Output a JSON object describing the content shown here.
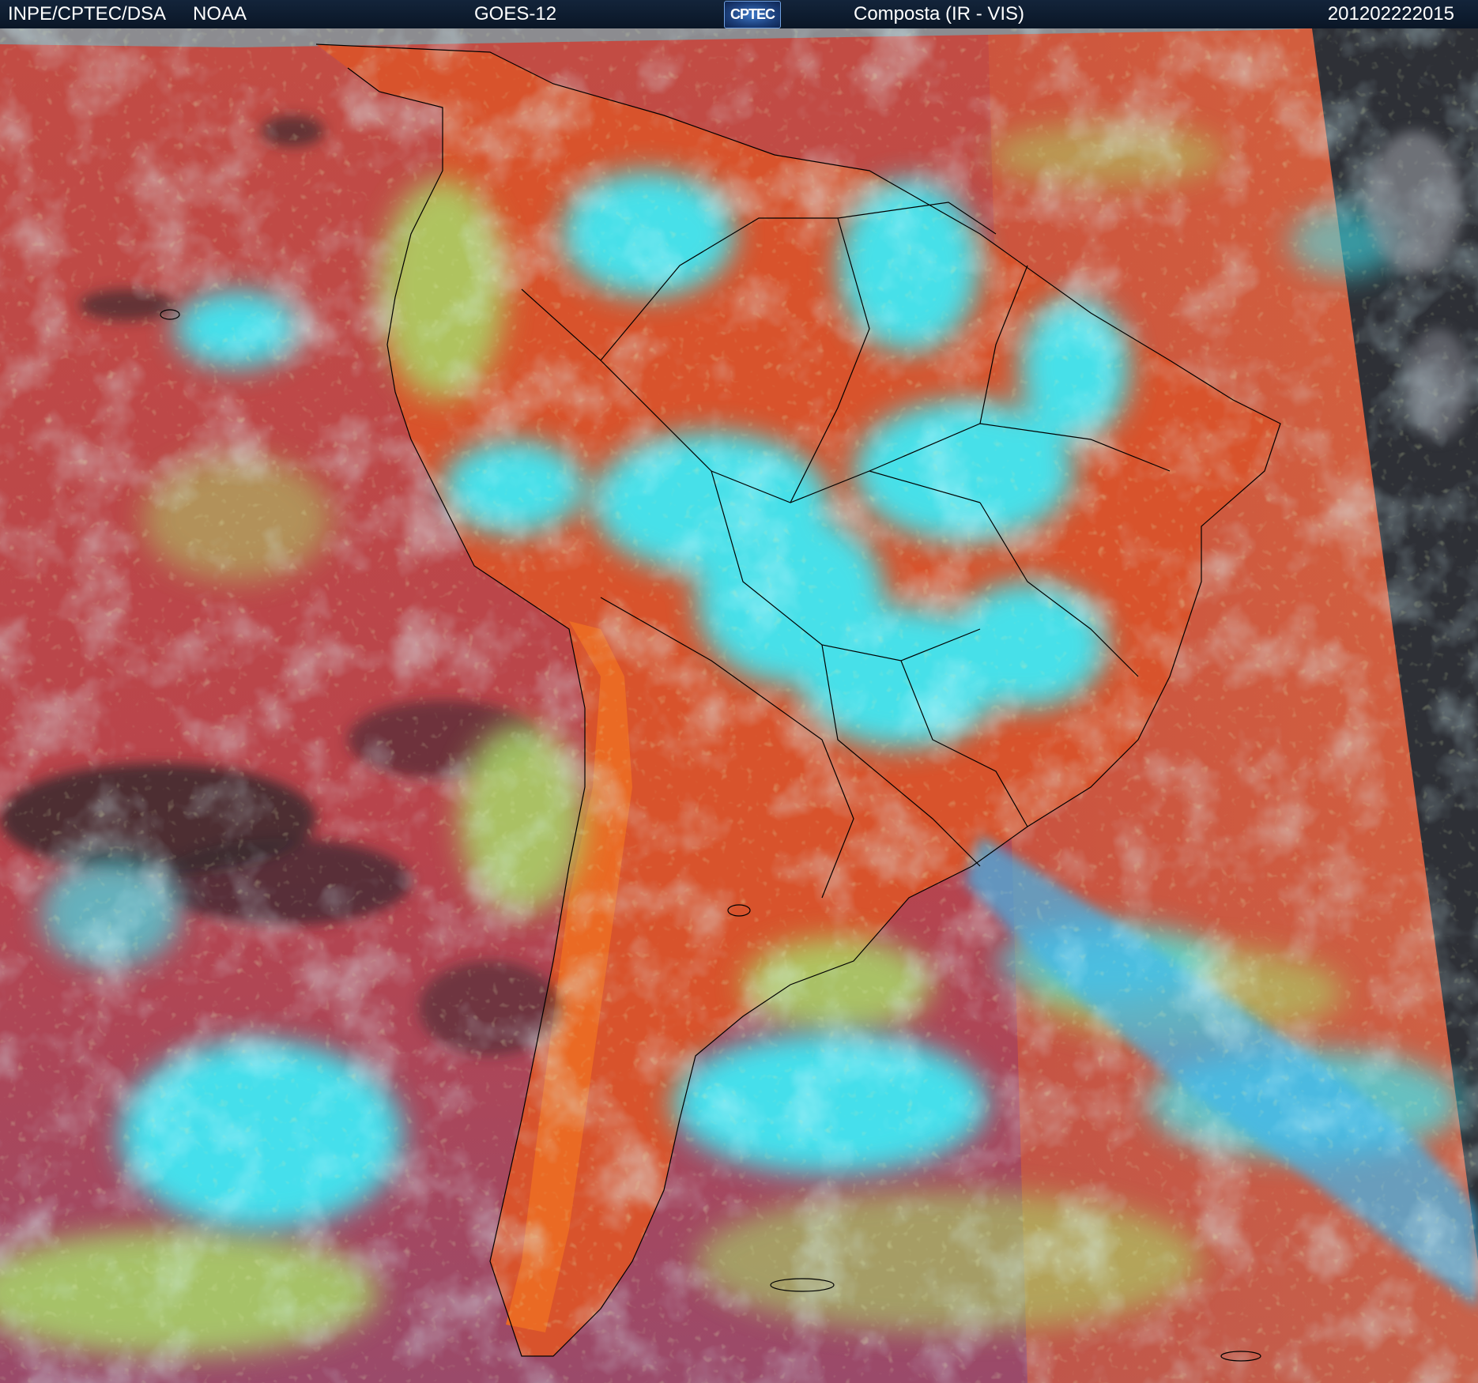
{
  "header": {
    "source": "INPE/CPTEC/DSA",
    "agency": "NOAA",
    "satellite": "GOES-12",
    "logo_text": "CPTEC",
    "product": "Composta (IR - VIS)",
    "timestamp": "201202222015"
  },
  "colors": {
    "header_bg": "#0a1626",
    "clear_land_ocean": "#c0504a",
    "warm_surface": "#e35a2a",
    "low_cloud": "#a8d86a",
    "high_cloud": "#3fe8f4",
    "cold_cloud_top": "#c8f8ff",
    "night_sector": "#2e3036",
    "borders": "#000000"
  },
  "map": {
    "region": "South America",
    "icons": [
      "country-border-lines",
      "state-border-lines",
      "coastline"
    ]
  }
}
